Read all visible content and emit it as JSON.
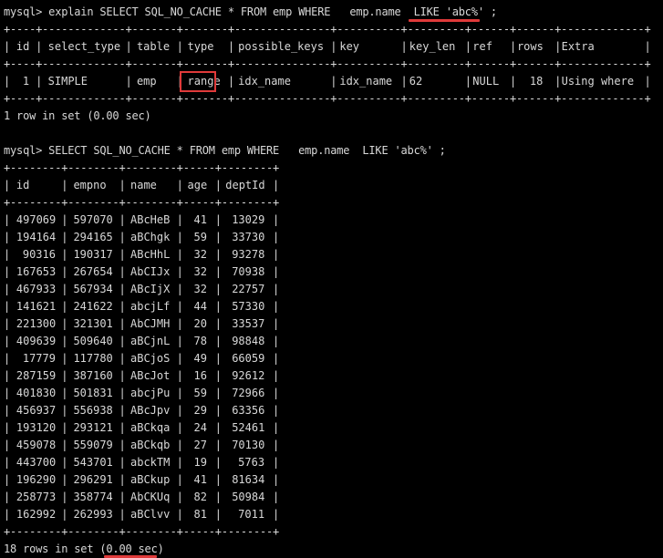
{
  "terminal": {
    "prompt": "mysql>",
    "commands": [
      "explain SELECT SQL_NO_CACHE * FROM emp WHERE   emp.name  LIKE 'abc%' ;",
      "SELECT SQL_NO_CACHE * FROM emp WHERE   emp.name  LIKE 'abc%' ;"
    ]
  },
  "explain": {
    "border_line": "+----+-------------+-------+-------+---------------+----------+---------+------+------+-------------+",
    "headers": [
      "id",
      "select_type",
      "table",
      "type",
      "possible_keys",
      "key",
      "key_len",
      "ref",
      "rows",
      "Extra"
    ],
    "row": [
      "1",
      "SIMPLE",
      "emp",
      "range",
      "idx_name",
      "idx_name",
      "62",
      "NULL",
      "18",
      "Using where"
    ],
    "status": "1 row in set (0.00 sec)"
  },
  "result": {
    "border_line": "+--------+--------+--------+-----+--------+",
    "headers": [
      "id",
      "empno",
      "name",
      "age",
      "deptId"
    ],
    "rows": [
      [
        "497069",
        "597070",
        "ABcHeB",
        "41",
        "13029"
      ],
      [
        "194164",
        "294165",
        "aBChgk",
        "59",
        "33730"
      ],
      [
        "90316",
        "190317",
        "ABcHhL",
        "32",
        "93278"
      ],
      [
        "167653",
        "267654",
        "AbCIJx",
        "32",
        "70938"
      ],
      [
        "467933",
        "567934",
        "ABcIjX",
        "32",
        "22757"
      ],
      [
        "141621",
        "241622",
        "abcjLf",
        "44",
        "57330"
      ],
      [
        "221300",
        "321301",
        "AbCJMH",
        "20",
        "33537"
      ],
      [
        "409639",
        "509640",
        "aBCjnL",
        "78",
        "98848"
      ],
      [
        "17779",
        "117780",
        "aBCjoS",
        "49",
        "66059"
      ],
      [
        "287159",
        "387160",
        "ABcJot",
        "16",
        "92612"
      ],
      [
        "401830",
        "501831",
        "abcjPu",
        "59",
        "72966"
      ],
      [
        "456937",
        "556938",
        "ABcJpv",
        "29",
        "63356"
      ],
      [
        "193120",
        "293121",
        "aBCkqa",
        "24",
        "52461"
      ],
      [
        "459078",
        "559079",
        "aBCkqb",
        "27",
        "70130"
      ],
      [
        "443700",
        "543701",
        "abckTM",
        "19",
        "5763"
      ],
      [
        "196290",
        "296291",
        "aBCkup",
        "41",
        "81634"
      ],
      [
        "258773",
        "358774",
        "AbCKUq",
        "82",
        "50984"
      ],
      [
        "162992",
        "262993",
        "aBClvv",
        "81",
        "7011"
      ]
    ],
    "status": "18 rows in set (0.00 sec)"
  },
  "colors": {
    "background": "#000000",
    "text": "#d8d8d8",
    "highlight": "#e03a3a"
  }
}
